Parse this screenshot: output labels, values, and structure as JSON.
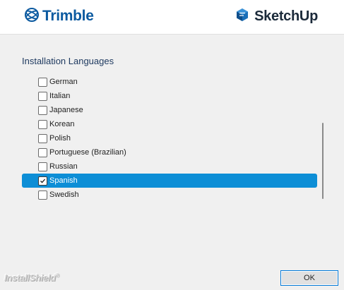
{
  "header": {
    "left_brand": "Trimble",
    "right_brand": "SketchUp"
  },
  "section": {
    "title": "Installation Languages"
  },
  "languages": [
    {
      "label": "German",
      "checked": false,
      "selected": false
    },
    {
      "label": "Italian",
      "checked": false,
      "selected": false
    },
    {
      "label": "Japanese",
      "checked": false,
      "selected": false
    },
    {
      "label": "Korean",
      "checked": false,
      "selected": false
    },
    {
      "label": "Polish",
      "checked": false,
      "selected": false
    },
    {
      "label": "Portuguese (Brazilian)",
      "checked": false,
      "selected": false
    },
    {
      "label": "Russian",
      "checked": false,
      "selected": false
    },
    {
      "label": "Spanish",
      "checked": true,
      "selected": true
    },
    {
      "label": "Swedish",
      "checked": false,
      "selected": false
    }
  ],
  "footer": {
    "installer_brand": "InstallShield",
    "ok_label": "OK"
  },
  "colors": {
    "trimble_blue": "#0c5aa0",
    "selection_blue": "#0d8ed6",
    "button_focus": "#0078d7"
  }
}
